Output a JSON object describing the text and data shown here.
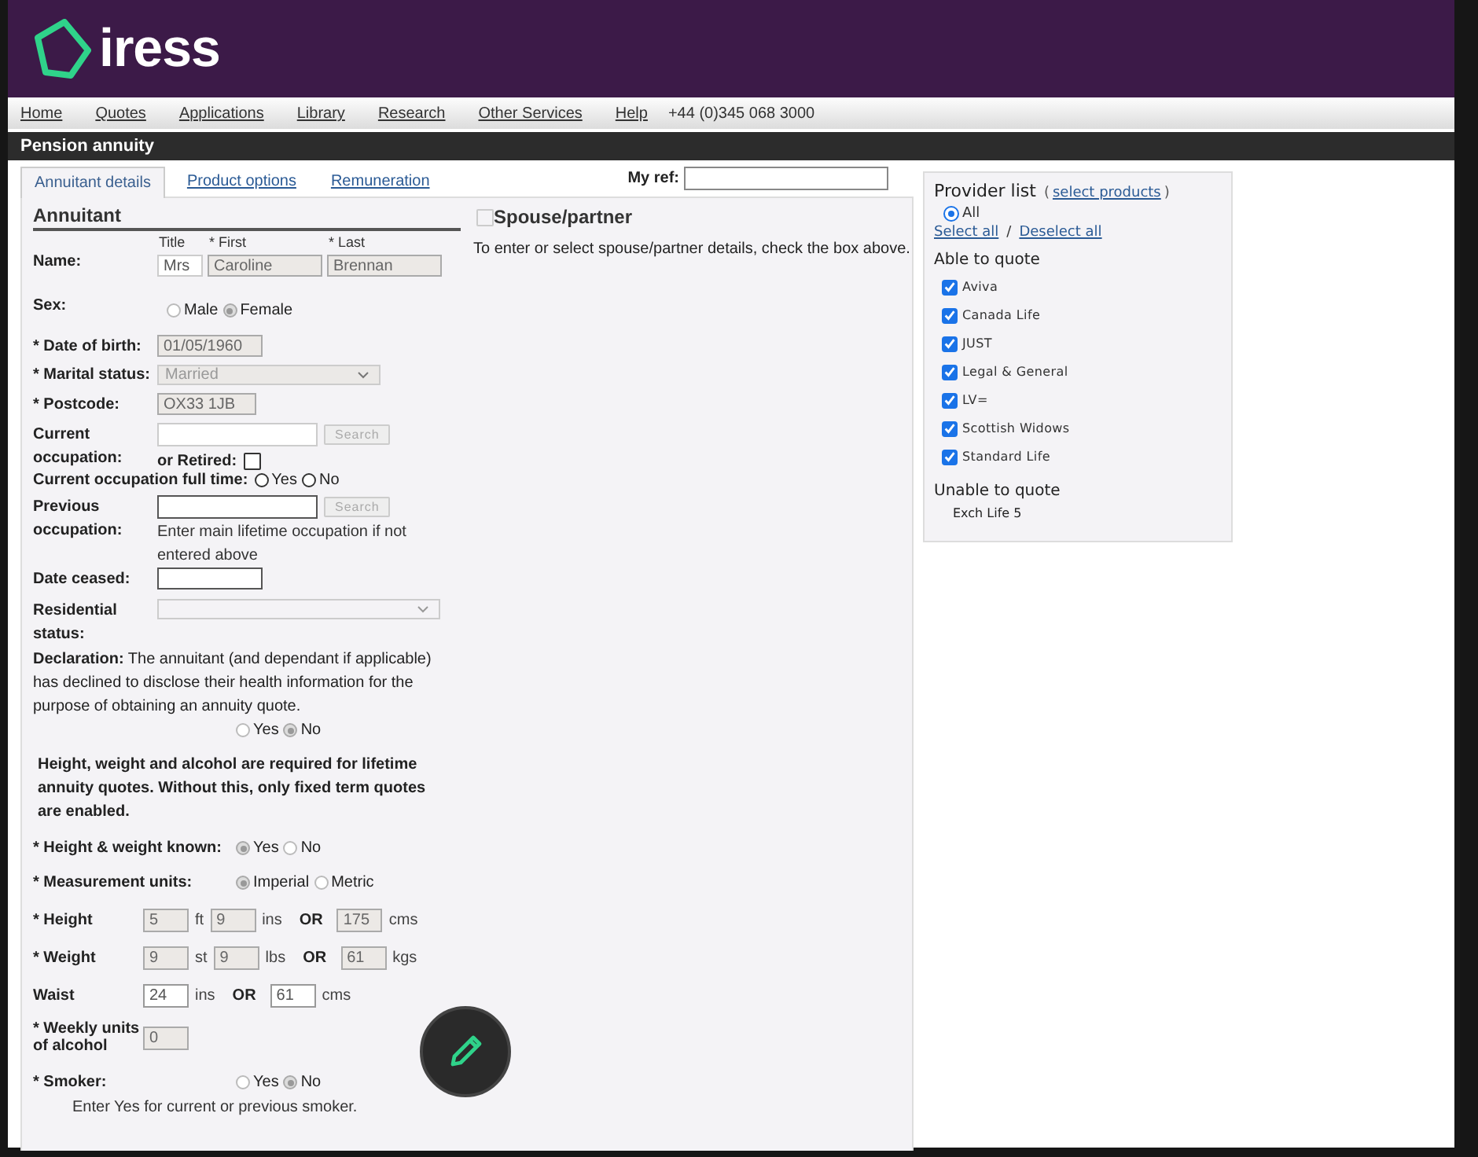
{
  "header": {
    "logo": "iress"
  },
  "nav": {
    "links": [
      "Home",
      "Quotes",
      "Applications",
      "Library",
      "Research",
      "Other Services",
      "Help"
    ],
    "phone": "+44 (0)345 068 3000"
  },
  "page_title": "Pension annuity",
  "tabs": [
    {
      "label": "Annuitant details",
      "selected": true
    },
    {
      "label": "Product options",
      "selected": false
    },
    {
      "label": "Remuneration",
      "selected": false
    }
  ],
  "my_ref": {
    "label": "My ref:"
  },
  "annuitant": {
    "heading": "Annuitant",
    "name": {
      "label": "Name:",
      "parts": [
        {
          "label": "Title",
          "value": "Mrs",
          "disabled": false
        },
        {
          "label": "* First",
          "value": "Caroline",
          "disabled": true
        },
        {
          "label": "* Last",
          "value": "Brennan",
          "disabled": true
        }
      ]
    },
    "sex": {
      "label": "Sex:",
      "disabled": true,
      "options": [
        {
          "label": "Male",
          "selected": false
        },
        {
          "label": "Female",
          "selected": true
        }
      ]
    },
    "dob": {
      "label": "* Date of birth:",
      "value": "01/05/1960"
    },
    "marital": {
      "label": "* Marital status:",
      "value": "Married",
      "disabled": true
    },
    "postcode": {
      "label": "* Postcode:",
      "value": "OX33 1JB"
    },
    "current_occupation": {
      "label": "Current occupation:",
      "button": "Search",
      "retired_label": "or Retired:",
      "retired_checked": false
    },
    "full_time": {
      "label": "Current occupation full time:",
      "disabled": false,
      "options": [
        {
          "label": "Yes",
          "selected": false
        },
        {
          "label": "No",
          "selected": false
        }
      ]
    },
    "previous_occupation": {
      "label": "Previous occupation:",
      "button": "Search",
      "hint": "Enter main lifetime occupation if not entered above"
    },
    "date_ceased": {
      "label": "Date ceased:"
    },
    "residential": {
      "label": "Residential status:"
    },
    "declaration": {
      "text": "**Declaration:** The annuitant (and dependant if applicable) has declined to disclose their health information for the purpose of obtaining an annuity quote.",
      "disabled": true,
      "options": [
        {
          "label": "Yes",
          "selected": false
        },
        {
          "label": "No",
          "selected": true
        }
      ]
    },
    "note": "Height, weight and alcohol are required for lifetime annuity quotes. Without this, only fixed term quotes are enabled.",
    "hw_known": {
      "label": "* Height & weight known:",
      "disabled": true,
      "options": [
        {
          "label": "Yes",
          "selected": true
        },
        {
          "label": "No",
          "selected": false
        }
      ]
    },
    "units": {
      "label": "* Measurement units:",
      "disabled": true,
      "options": [
        {
          "label": "Imperial",
          "selected": true
        },
        {
          "label": "Metric",
          "selected": false
        }
      ]
    },
    "measures": [
      {
        "label": "* Height",
        "parts": [
          {
            "kind": "field",
            "value": "5",
            "disabled": true
          },
          {
            "kind": "unit",
            "text": "ft"
          },
          {
            "kind": "field",
            "value": "9",
            "disabled": true
          },
          {
            "kind": "unit",
            "text": "ins"
          },
          {
            "kind": "or",
            "text": "OR"
          },
          {
            "kind": "field",
            "value": "175",
            "disabled": true
          },
          {
            "kind": "unit",
            "text": "cms"
          }
        ]
      },
      {
        "label": "* Weight",
        "parts": [
          {
            "kind": "field",
            "value": "9",
            "disabled": true
          },
          {
            "kind": "unit",
            "text": "st"
          },
          {
            "kind": "field",
            "value": "9",
            "disabled": true
          },
          {
            "kind": "unit",
            "text": "lbs"
          },
          {
            "kind": "or",
            "text": "OR"
          },
          {
            "kind": "field",
            "value": "61",
            "disabled": true
          },
          {
            "kind": "unit",
            "text": "kgs"
          }
        ]
      },
      {
        "label": "Waist",
        "parts": [
          {
            "kind": "field",
            "value": "24",
            "disabled": false
          },
          {
            "kind": "unit",
            "text": "ins"
          },
          {
            "kind": "or",
            "text": "OR"
          },
          {
            "kind": "field",
            "value": "61",
            "disabled": false
          },
          {
            "kind": "unit",
            "text": "cms"
          }
        ]
      },
      {
        "label": "* Weekly units of alcohol",
        "parts": [
          {
            "kind": "field",
            "value": "0",
            "disabled": true
          }
        ]
      }
    ],
    "smoker": {
      "label": "* Smoker:",
      "disabled": true,
      "options": [
        {
          "label": "Yes",
          "selected": false
        },
        {
          "label": "No",
          "selected": true
        }
      ],
      "hint": "Enter Yes for current or previous smoker."
    }
  },
  "spouse": {
    "title": "Spouse/partner",
    "checked": false,
    "hint": "To enter or select spouse/partner details, check the box above."
  },
  "providers": {
    "title": "Provider list",
    "link": "select products",
    "open_paren": "(",
    "close_paren": ")",
    "all": {
      "label": "All",
      "selected": true
    },
    "select_all": "Select all",
    "separator": "/",
    "deselect_all": "Deselect all",
    "able_heading": "Able to quote",
    "able": [
      {
        "name": "Aviva",
        "checked": true
      },
      {
        "name": "Canada Life",
        "checked": true
      },
      {
        "name": "JUST",
        "checked": true
      },
      {
        "name": "Legal & General",
        "checked": true
      },
      {
        "name": "LV=",
        "checked": true
      },
      {
        "name": "Scottish Widows",
        "checked": true
      },
      {
        "name": "Standard Life",
        "checked": true
      }
    ],
    "unable_heading": "Unable to quote",
    "unable": [
      "Exch Life 5"
    ]
  }
}
